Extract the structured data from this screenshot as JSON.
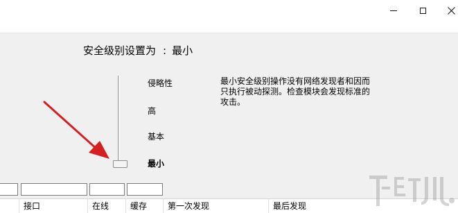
{
  "window": {
    "minimize_icon": "minimize-icon",
    "maximize_icon": "maximize-icon",
    "close_icon": "close-icon"
  },
  "security": {
    "heading_label": "安全级别设置为",
    "colon": ":",
    "current_level": "最小",
    "levels": [
      "侵略性",
      "高",
      "基本",
      "最小"
    ],
    "selected_level_index": 3,
    "description": "最小安全级别操作没有网络发现者和因而只执行被动探测。检查模块会发现标准的攻击。"
  },
  "table": {
    "columns": [
      "接口",
      "在线",
      "缓存",
      "第一次发现",
      "最后发现"
    ]
  },
  "colors": {
    "arrow": "#d42020",
    "background": "#f0f0f0"
  }
}
